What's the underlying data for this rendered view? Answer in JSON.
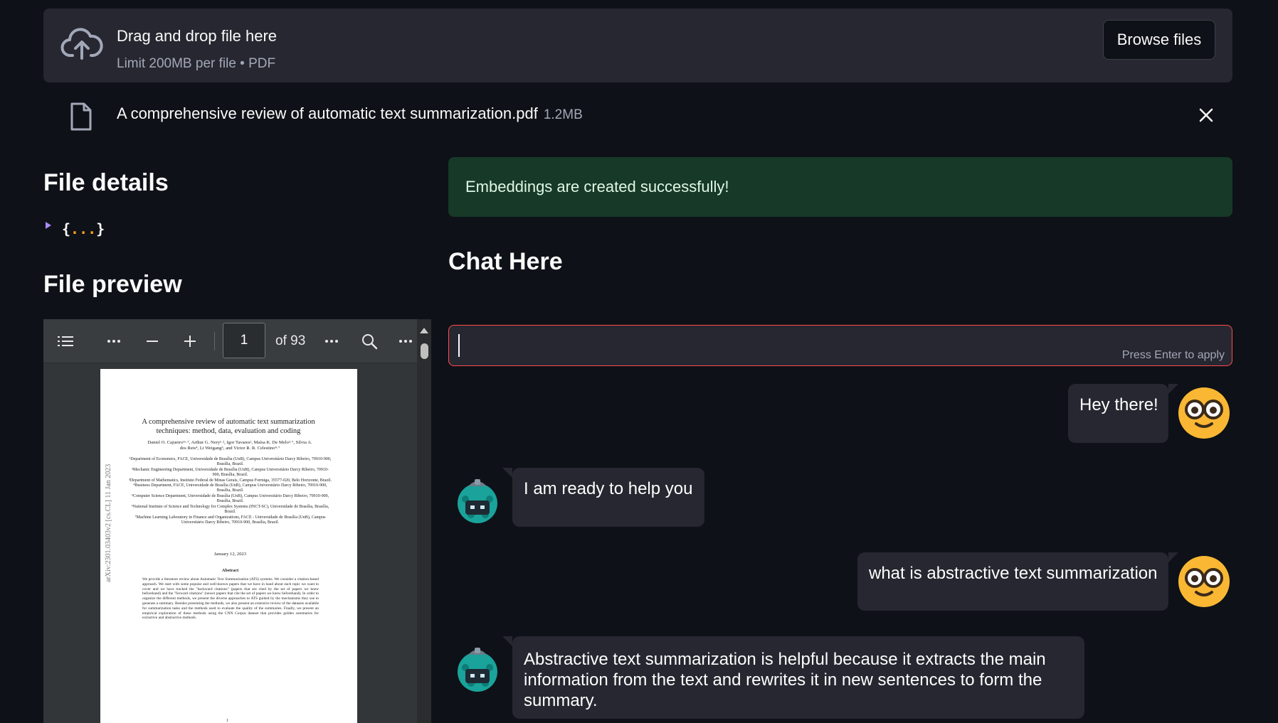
{
  "uploader": {
    "icon": "cloud-upload-icon",
    "title": "Drag and drop file here",
    "subtitle": "Limit 200MB per file • PDF",
    "browse_label": "Browse files"
  },
  "uploaded_file": {
    "icon": "file-icon",
    "name": "A comprehensive review of automatic text summarization.pdf",
    "size": "1.2MB",
    "remove_icon": "close-icon"
  },
  "file_details": {
    "heading": "File details",
    "json_open": "{",
    "json_dots": "...",
    "json_close": "}"
  },
  "file_preview": {
    "heading": "File preview",
    "toolbar": {
      "page_value": "1",
      "page_of": "of 93"
    },
    "page": {
      "title_lines": [
        "A comprehensive review of automatic text summarization",
        "techniques: method, data, evaluation and coding"
      ],
      "authors_lines": [
        "Daniel O. Cajueiro¹ᵃ·⁷, Arthur G. Nery¹·², Igor Tavares², Maísa K. De Melo³·⁷, Silvia A.",
        "dos Reis⁴, Li Weigang⁵, and Victor R. R. Celestino⁴·⁷"
      ],
      "affiliations": [
        "¹Department of Economics, FACE, Universidade de Brasília (UnB), Campus Universitário Darcy Ribeiro, 70910-900, Brasília, Brazil.",
        "²Mechanic Engineering Department, Universidade de Brasília (UnB), Campus Universitário Darcy Ribeiro, 70910-900, Brasília, Brazil.",
        "³Department of Mathematics, Instituto Federal de Minas Gerais, Campus Formiga, 35577-020, Belo Horizonte, Brazil.",
        "⁴Business Department, FACE, Universidade de Brasília (UnB), Campus Universitário Darcy Ribeiro, 70910-900, Brasília, Brazil.",
        "⁵Computer Science Department, Universidade de Brasília (UnB), Campus Universitário Darcy Ribeiro, 70910-900, Brasília, Brazil.",
        "⁶National Institute of Science and Technology for Complex Systems (INCT-SC), Universidade de Brasília, Brasília, Brazil.",
        "⁷Machine Learning Laboratory in Finance and Organizations, FACE - Universidade de Brasília (UnB), Campus Universitário Darcy Ribeiro, 70910-900, Brasília, Brazil."
      ],
      "date": "January 12, 2023",
      "abstract_heading": "Abstract",
      "abstract_text": "We provide a literature review about Automatic Text Summarization (ATS) systems. We consider a citation-based approach. We start with some popular and well-known papers that we have in hand about each topic we want to cover and we have tracked the \"backward citations\" (papers that are cited by the set of papers we knew beforehand) and the \"forward citations\" (newer papers that cite the set of papers we knew beforehand). In order to organize the different methods, we present the diverse approaches to ATS guided by the mechanisms they use to generate a summary. Besides presenting the methods, we also present an extensive review of the datasets available for summarization tasks and the methods used to evaluate the quality of the summaries. Finally, we present an empirical exploration of these methods using the CNN Corpus dataset that provides golden summaries for extractive and abstractive methods.",
      "arxiv_stamp": "arXiv:2301.03403v2  [cs.CL]  11 Jan 2023",
      "page_number": "1"
    }
  },
  "status": {
    "success_text": "Embeddings are created successfully!",
    "color": "#173928"
  },
  "chat": {
    "heading": "Chat Here",
    "input_value": "",
    "input_hint": "Press Enter to apply",
    "messages": [
      {
        "role": "user",
        "avatar": "nerd-face-icon",
        "text": "Hey there!"
      },
      {
        "role": "assistant",
        "avatar": "robot-icon",
        "text": "I am ready to help you"
      },
      {
        "role": "user",
        "avatar": "nerd-face-icon",
        "text": "what is abstractive text summarization"
      },
      {
        "role": "assistant",
        "avatar": "robot-icon",
        "text": "Abstractive text summarization is helpful because it extracts the main information from the text and rewrites it in new sentences to form the summary."
      }
    ]
  },
  "colors": {
    "background": "#0e1117",
    "panel": "#262730",
    "accent_red": "#ff4b4b",
    "success_bg": "#173928"
  }
}
